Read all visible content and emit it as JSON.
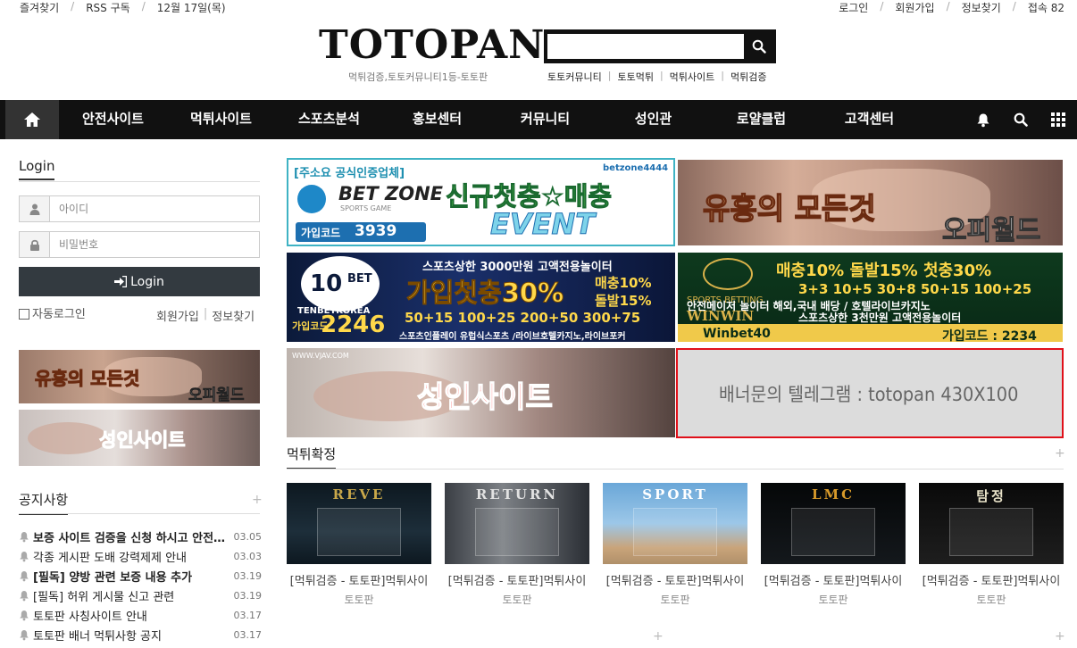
{
  "topbar": {
    "left": [
      "즐겨찾기",
      "RSS 구독",
      "12월 17일(목)"
    ],
    "right": [
      "로그인",
      "회원가입",
      "정보찾기",
      "접속 82"
    ]
  },
  "header": {
    "logo": "TOTOPAN",
    "tagline": "먹튀검증,토토커뮤니티1등-토토판",
    "search_placeholder": "",
    "quicklinks": [
      "토토커뮤니티",
      "토토먹튀",
      "먹튀사이트",
      "먹튀검증"
    ]
  },
  "nav": {
    "items": [
      "안전사이트",
      "먹튀사이트",
      "스포츠분석",
      "홍보센터",
      "커뮤니티",
      "성인관",
      "로얄클럽",
      "고객센터"
    ]
  },
  "login": {
    "title": "Login",
    "id_placeholder": "아이디",
    "pw_placeholder": "비밀번호",
    "button": "Login",
    "auto": "자동로그인",
    "join": "회원가입",
    "find": "정보찾기"
  },
  "banners": {
    "betzone": {
      "tag": "[주소요 공식인증업체]",
      "handle": "betzone4444",
      "brand": "BET ZONE",
      "sub": "SPORTS GAME",
      "headline": "신규첫충☆매충",
      "event": "EVENT",
      "code_label": "가입코드",
      "code": "3939"
    },
    "opiworld": {
      "headline": "유흥의 모든것",
      "brand": "오피월드"
    },
    "tenbet": {
      "top": "스포츠상한 3000만원 고액전용놀이터",
      "headline": "가입첫충30%",
      "right1": "매충10%",
      "right2": "돌발15%",
      "tag": "TENBETKOREA",
      "code_label": "가입코드",
      "code": "2246",
      "line": "50+15 100+25 200+50 300+75",
      "bottom": "스포츠인플레이 유럽식스포츠 /라이브호텔카지노,라이브포커"
    },
    "winwin": {
      "headline": "매충10% 돌발15% 첫충30%",
      "line1": "3+3 10+5 30+8 50+15 100+25",
      "line2": "안전메이저 놀이터   해외,국내 배당 / 호텔라이브카지노",
      "brand": "WINWIN",
      "line3": "스포츠상한 3천만원 고액전용놀이터",
      "sub": "SPORTS BETTING",
      "telegram": "Winbet40",
      "code": "가입코드 : 2234"
    },
    "adult": {
      "headline": "성인사이트",
      "site": "WWW.VJAV.COM"
    },
    "ad_slot": {
      "text": "배너문의 텔레그램 : totopan    430X100"
    },
    "left1": {
      "headline": "유흥의 모든것",
      "brand": "오피월드"
    },
    "left2": {
      "headline": "성인사이트"
    }
  },
  "notice": {
    "title": "공지사항",
    "items": [
      {
        "title": "보증 사이트 검증을 신청 하시고 안전놀이터",
        "date": "03.05",
        "bold": true
      },
      {
        "title": "각종 게시판 도배 강력제제 안내",
        "date": "03.03",
        "bold": false
      },
      {
        "title": "[필독] 양방 관련 보증 내용 추가",
        "date": "03.19",
        "bold": true
      },
      {
        "title": "[필독] 허위 게시물 신고 관련",
        "date": "03.19",
        "bold": false
      },
      {
        "title": "토토판 사칭사이트 안내",
        "date": "03.17",
        "bold": false
      },
      {
        "title": "토토판 배너 먹튀사항 공지",
        "date": "03.17",
        "bold": false
      }
    ]
  },
  "section": {
    "title": "먹튀확정",
    "cards": [
      {
        "title": "[먹튀검증 - 토토판]먹튀사이",
        "source": "토토판",
        "logo": "REVE"
      },
      {
        "title": "[먹튀검증 - 토토판]먹튀사이",
        "source": "토토판",
        "logo": "RETURN"
      },
      {
        "title": "[먹튀검증 - 토토판]먹튀사이",
        "source": "토토판",
        "logo": "SPORT"
      },
      {
        "title": "[먹튀검증 - 토토판]먹튀사이",
        "source": "토토판",
        "logo": "LMC"
      },
      {
        "title": "[먹튀검증 - 토토판]먹튀사이",
        "source": "토토판",
        "logo": "탐정"
      }
    ]
  },
  "colors": {
    "nav_bg": "#111111",
    "accent_red": "#e02020",
    "ad_border": "#e0101a"
  }
}
